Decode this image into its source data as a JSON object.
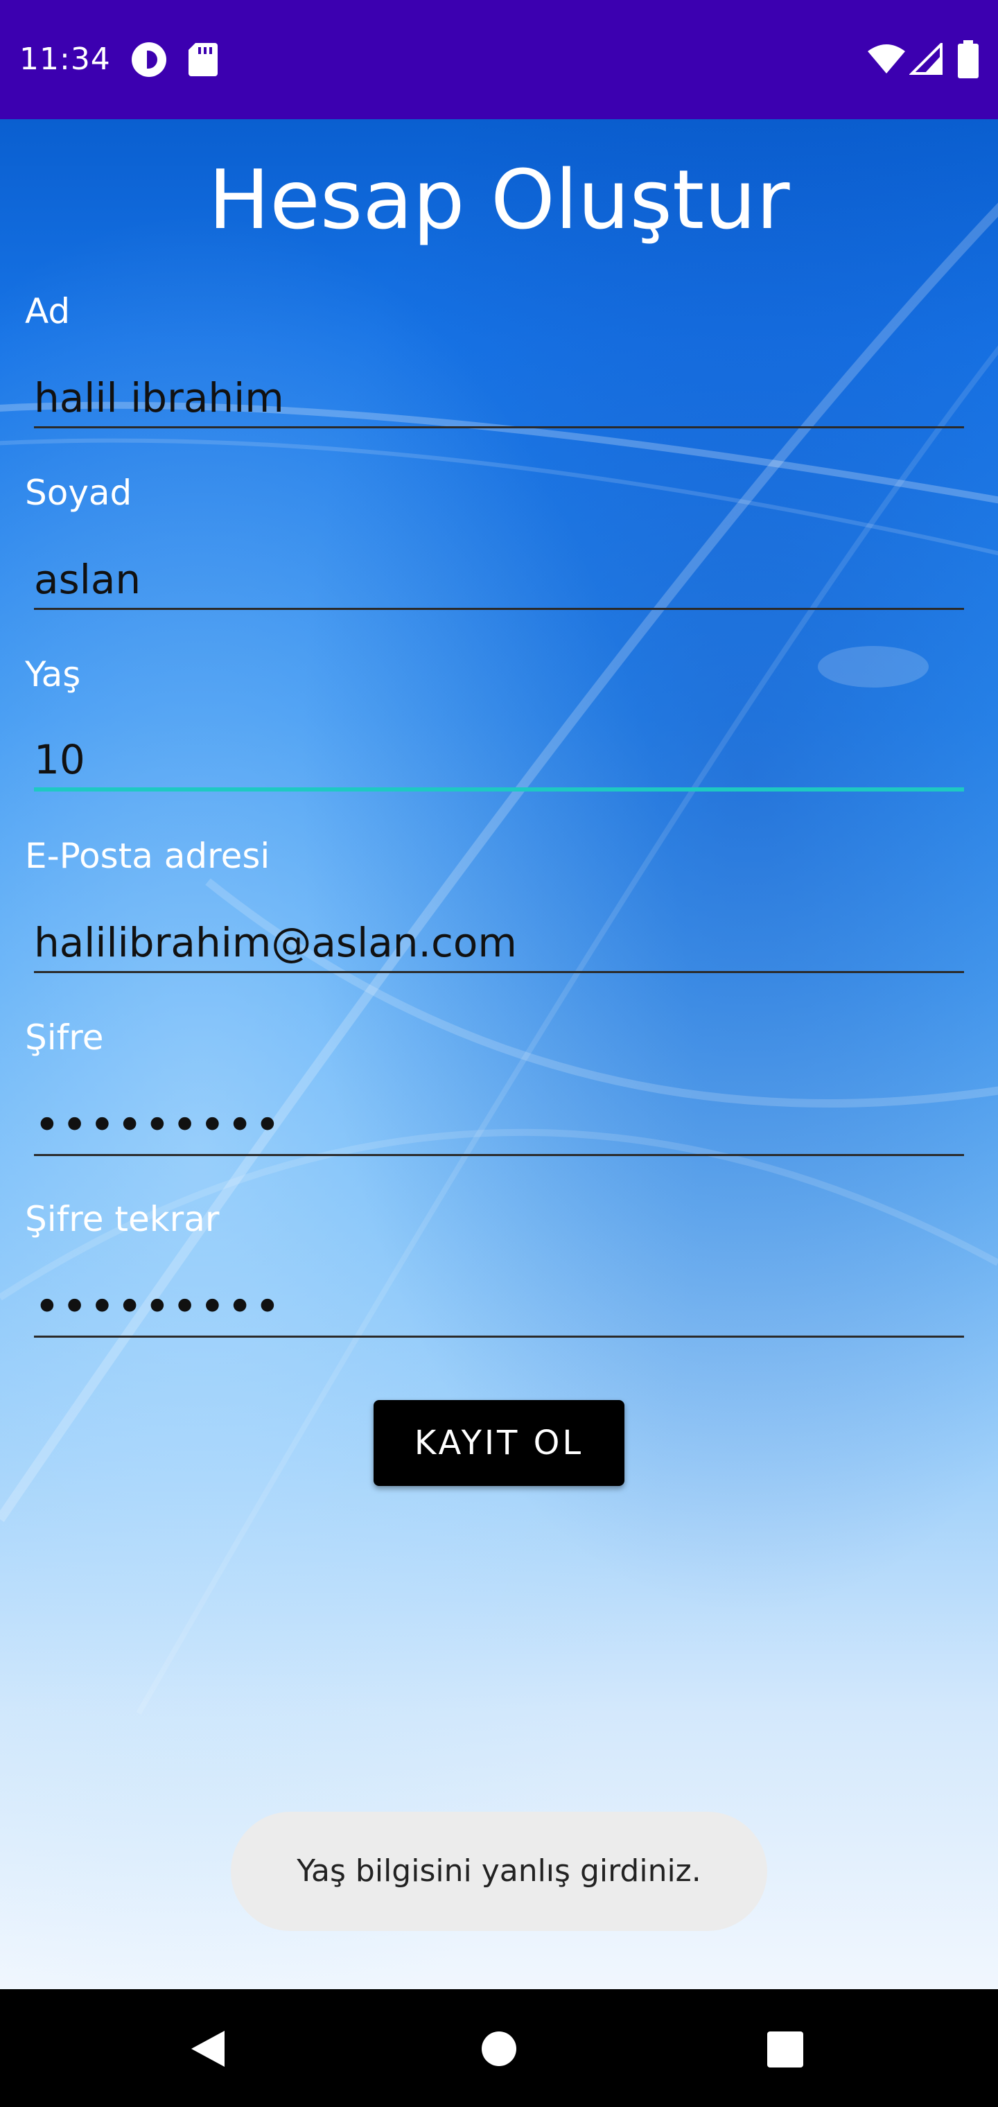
{
  "status_bar": {
    "time": "11:34",
    "icons": [
      "notification-app-icon",
      "sd-card-icon",
      "wifi-icon",
      "cell-signal-icon",
      "battery-icon"
    ]
  },
  "page": {
    "title": "Hesap Oluştur"
  },
  "form": {
    "first_name": {
      "label": "Ad",
      "value": "halil ibrahim"
    },
    "last_name": {
      "label": "Soyad",
      "value": "aslan"
    },
    "age": {
      "label": "Yaş",
      "value": "10"
    },
    "email": {
      "label": "E-Posta adresi",
      "value": "halilibrahim@aslan.com"
    },
    "password": {
      "label": "Şifre",
      "value": "•••••••••"
    },
    "password_repeat": {
      "label": "Şifre tekrar",
      "value": "•••••••••"
    },
    "submit_label": "KAYIT OL"
  },
  "toast": {
    "message": "Yaş bilgisini yanlış girdiniz."
  },
  "nav_bar": {
    "icons": [
      "back-icon",
      "home-icon",
      "recents-icon"
    ]
  },
  "colors": {
    "status_bar": "#3c00b0",
    "focus_underline": "#1ec9c2",
    "button_bg": "#000000",
    "toast_bg": "#ececec"
  }
}
